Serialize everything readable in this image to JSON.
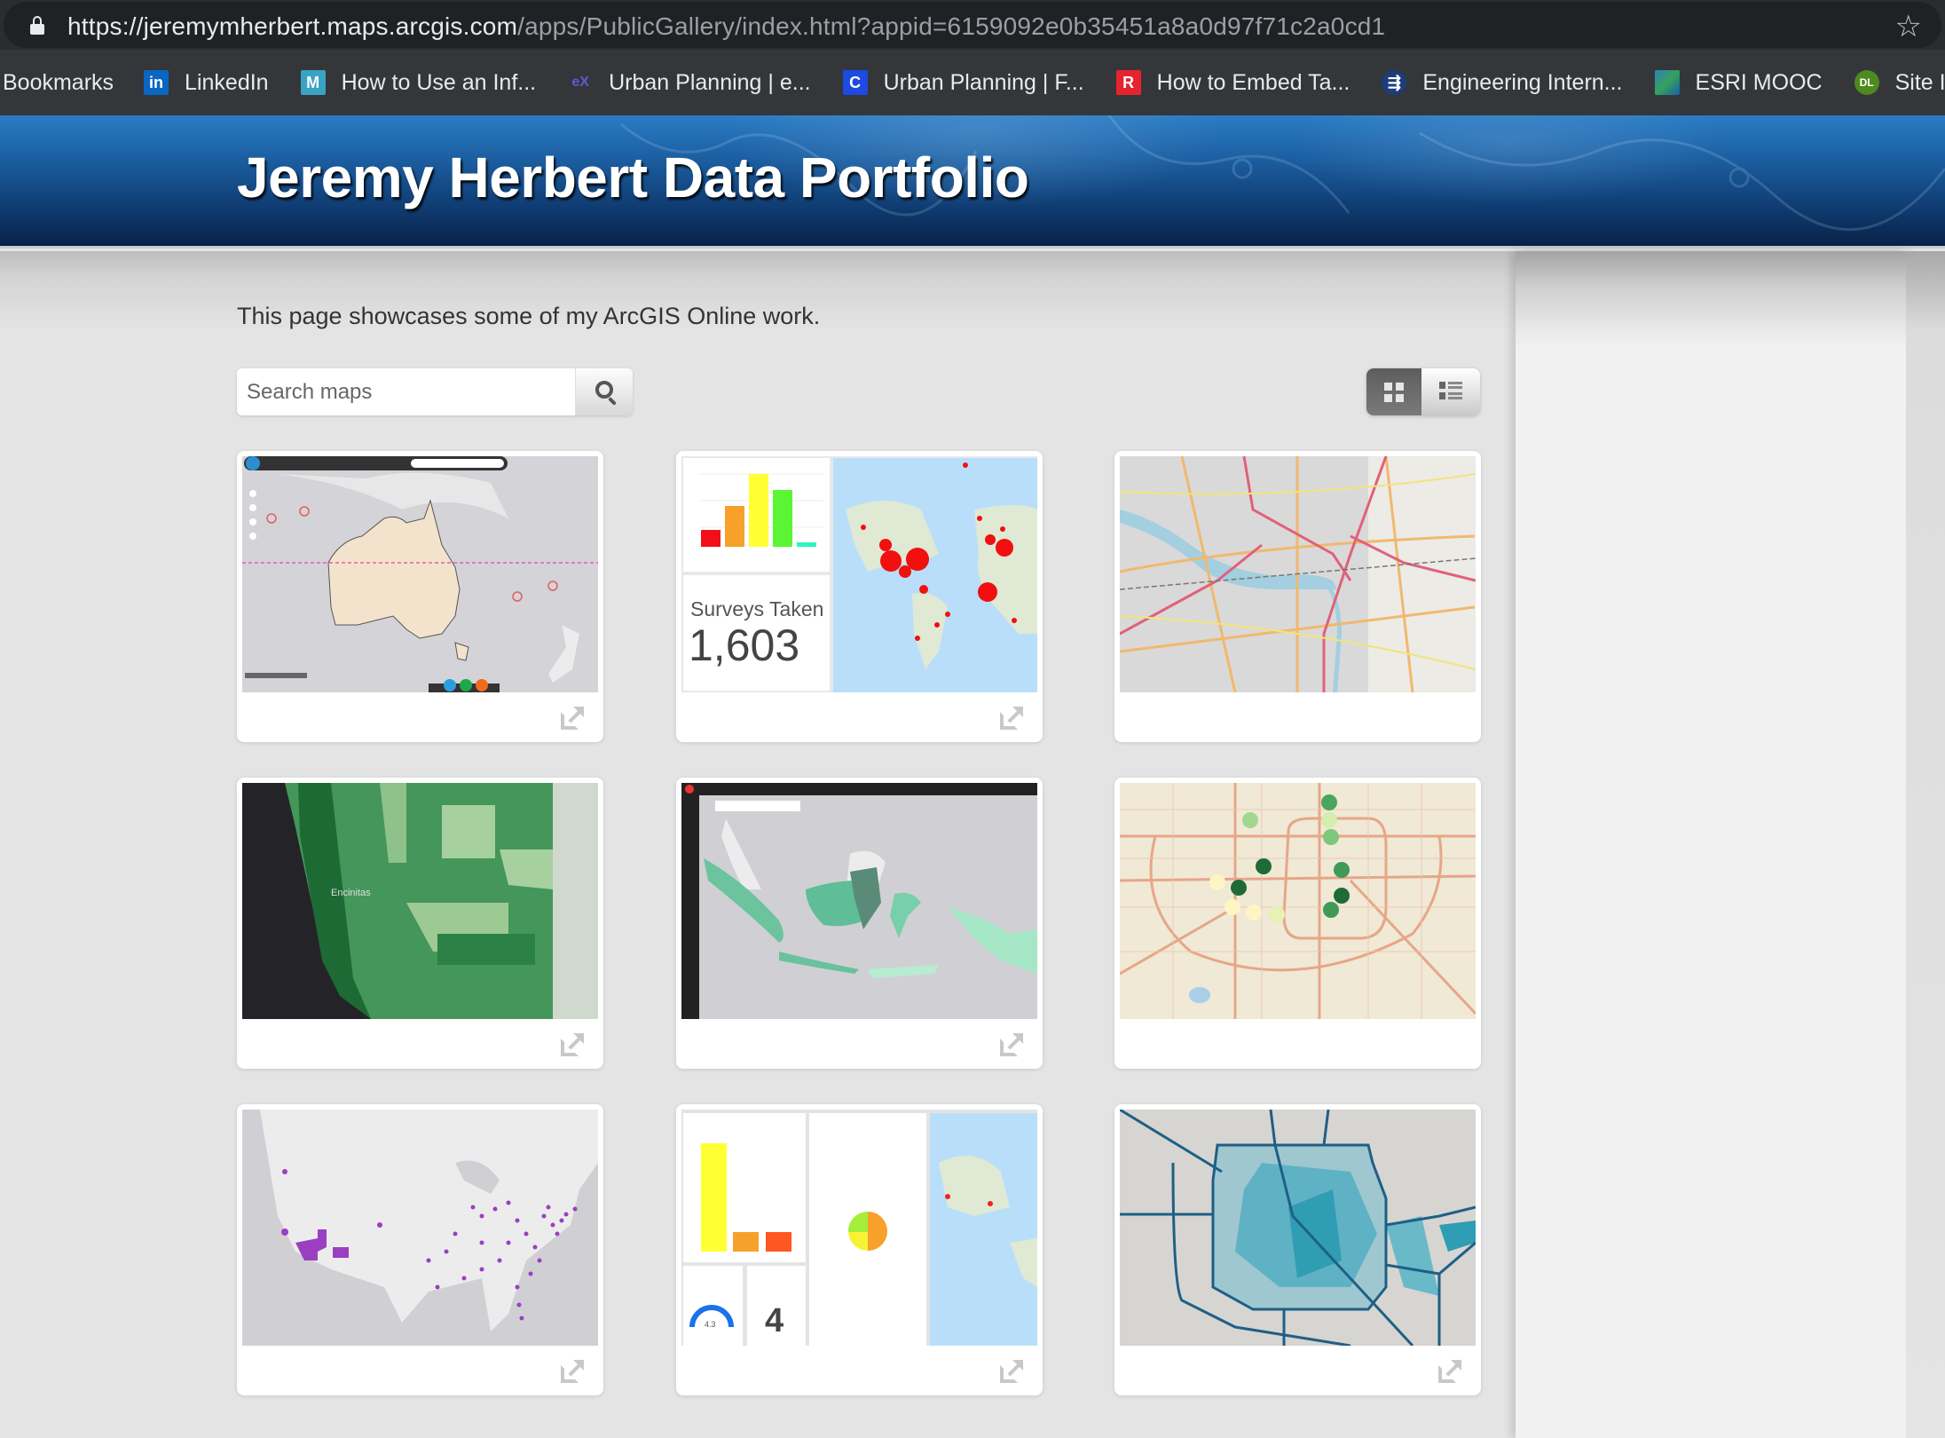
{
  "browser": {
    "url_host": "https://jeremymherbert.maps.arcgis.com",
    "url_path": "/apps/PublicGallery/index.html?appid=6159092e0b35451a8a0d97f71c2a0cd1",
    "bookmarks_label": "Bookmarks",
    "bookmarks": [
      {
        "label": "LinkedIn",
        "icon": "linkedin-icon",
        "glyph": "in"
      },
      {
        "label": "How to Use an Inf...",
        "icon": "m-site-icon",
        "glyph": "M"
      },
      {
        "label": "Urban Planning | e...",
        "icon": "edx-icon",
        "glyph": "eX"
      },
      {
        "label": "Urban Planning | F...",
        "icon": "c-site-icon",
        "glyph": "C"
      },
      {
        "label": "How to Embed Ta...",
        "icon": "r-site-icon",
        "glyph": "R"
      },
      {
        "label": "Engineering Intern...",
        "icon": "engineering-site-icon",
        "glyph": "⇶"
      },
      {
        "label": "ESRI MOOC",
        "icon": "esri-icon",
        "glyph": ""
      },
      {
        "label": "Site I",
        "icon": "dl-site-icon",
        "glyph": "DL"
      }
    ]
  },
  "header": {
    "title": "Jeremy Herbert Data Portfolio"
  },
  "main": {
    "intro": "This page showcases some of my ArcGIS Online work.",
    "search": {
      "placeholder": "Search maps",
      "value": ""
    },
    "view_toggle": {
      "active": "grid",
      "options": [
        "grid",
        "list"
      ]
    },
    "gallery": [
      {
        "thumb": "australia-map",
        "has_external_link": true
      },
      {
        "thumb": "survey-dashboard",
        "has_external_link": true,
        "dashboard_label": "Surveys Taken",
        "dashboard_value": "1,603"
      },
      {
        "thumb": "richmond-street-map",
        "has_external_link": false
      },
      {
        "thumb": "encinitas-choropleth",
        "has_external_link": true,
        "map_label": "Encinitas"
      },
      {
        "thumb": "indonesia-map",
        "has_external_link": true
      },
      {
        "thumb": "houston-points-map",
        "has_external_link": false
      },
      {
        "thumb": "usa-purple-points",
        "has_external_link": true
      },
      {
        "thumb": "survey-dashboard-2",
        "has_external_link": true,
        "gauge_value": "4.3",
        "count_value": "4"
      },
      {
        "thumb": "houston-blue-choropleth",
        "has_external_link": true
      }
    ]
  },
  "colors": {
    "banner_top": "#2a7cc4",
    "banner_bottom": "#0a2147",
    "page_bg": "#e4e4e4",
    "panel_bg": "#f1f1f1",
    "toggle_active": "#666666"
  }
}
